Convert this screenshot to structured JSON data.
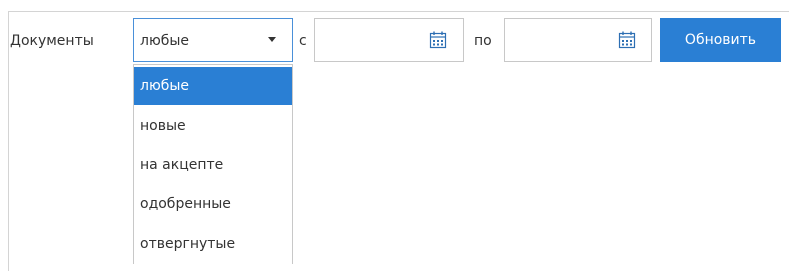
{
  "filter": {
    "documents_label": "Документы",
    "selected_value": "любые",
    "from_label": "с",
    "to_label": "по",
    "from_date": "",
    "to_date": "",
    "refresh_label": "Обновить"
  },
  "dropdown": {
    "options": [
      "любые",
      "новые",
      "на акцепте",
      "одобренные",
      "отвергнутые"
    ],
    "selected_index": 0
  },
  "colors": {
    "accent": "#2a7fd4",
    "focus_border": "#4a90d9",
    "border": "#c8c8c8",
    "icon": "#2d6fb3"
  }
}
